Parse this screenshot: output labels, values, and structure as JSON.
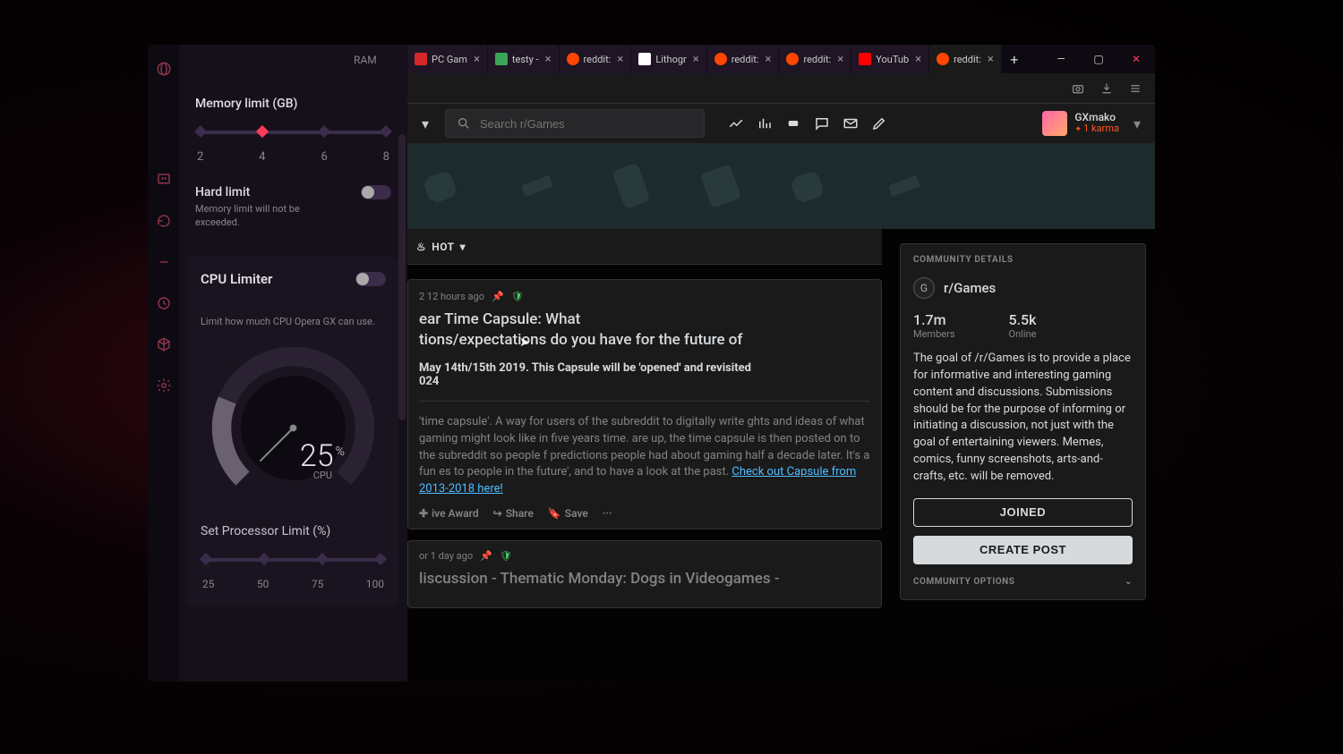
{
  "panel": {
    "ram_label": "RAM",
    "memory": {
      "title": "Memory limit (GB)",
      "ticks": [
        "2",
        "4",
        "6",
        "8"
      ],
      "active_index": 1,
      "hard_limit_title": "Hard limit",
      "hard_limit_desc": "Memory limit will not be exceeded.",
      "hard_limit_on": false
    },
    "cpu": {
      "title": "CPU Limiter",
      "enabled": false,
      "desc": "Limit how much CPU Opera GX can use.",
      "value": "25",
      "unit": "%",
      "label": "CPU",
      "proc_title": "Set Processor Limit (%)",
      "proc_ticks": [
        "25",
        "50",
        "75",
        "100"
      ]
    }
  },
  "tabs": [
    {
      "title": "PC Gam",
      "color": "#d62828"
    },
    {
      "title": "testy - ",
      "color": "#3aa655"
    },
    {
      "title": "reddit:",
      "color": "#ff4500"
    },
    {
      "title": "Lithogr",
      "color": "#ffffff"
    },
    {
      "title": "reddit:",
      "color": "#ff4500"
    },
    {
      "title": "reddit:",
      "color": "#ff4500"
    },
    {
      "title": "YouTub",
      "color": "#ff0000"
    },
    {
      "title": "reddit:",
      "color": "#ff4500",
      "active": true
    }
  ],
  "search": {
    "placeholder": "Search r/Games"
  },
  "user": {
    "name": "GXmako",
    "karma": "1 karma"
  },
  "sort": {
    "label": "HOT"
  },
  "post1": {
    "meta": "2 12 hours ago",
    "title_a": "ear Time Capsule: What",
    "title_b": "tions/expectations do you have for the future of",
    "subtitle": "May 14th/15th 2019. This Capsule will be 'opened' and revisited\n024",
    "body": "'time capsule'. A way for users of the subreddit to digitally write ghts and ideas of what gaming might look like in five years time. are up, the time capsule is then posted on to the subreddit so people f predictions people had about gaming half a decade later. It's a fun es to people in the future', and to have a look at the past. ",
    "link": "Check out Capsule from 2013-2018 here!",
    "actions": {
      "award": "ive Award",
      "share": "Share",
      "save": "Save"
    }
  },
  "post2": {
    "meta": "or 1 day ago",
    "title": "liscussion - Thematic Monday: Dogs in Videogames -"
  },
  "community": {
    "hdr": "COMMUNITY DETAILS",
    "name": "r/Games",
    "members_n": "1.7m",
    "members_l": "Members",
    "online_n": "5.5k",
    "online_l": "Online",
    "desc": "The goal of /r/Games is to provide a place for informative and interesting gaming content and discussions. Submissions should be for the purpose of informing or initiating a discussion, not just with the goal of entertaining viewers. Memes, comics, funny screenshots, arts-and-crafts, etc. will be removed.",
    "joined": "JOINED",
    "create": "CREATE POST",
    "options": "COMMUNITY OPTIONS"
  }
}
